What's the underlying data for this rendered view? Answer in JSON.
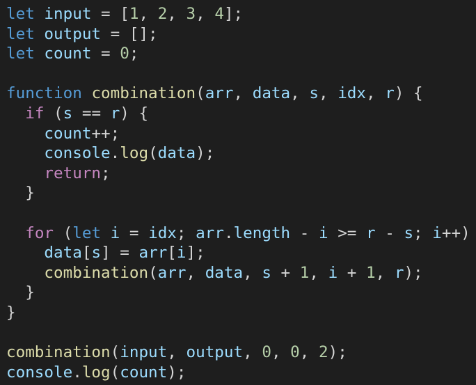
{
  "colors": {
    "background": "#1e1e1e",
    "keyword": "#569cd6",
    "control": "#c586c0",
    "variable": "#9cdcfe",
    "function": "#dcdcaa",
    "number": "#b5cea8",
    "punctuation": "#d4d4d4"
  },
  "lines": [
    [
      [
        "kw",
        "let"
      ],
      [
        "pun",
        " "
      ],
      [
        "var",
        "input"
      ],
      [
        "pun",
        " = ["
      ],
      [
        "num",
        "1"
      ],
      [
        "pun",
        ", "
      ],
      [
        "num",
        "2"
      ],
      [
        "pun",
        ", "
      ],
      [
        "num",
        "3"
      ],
      [
        "pun",
        ", "
      ],
      [
        "num",
        "4"
      ],
      [
        "pun",
        "];"
      ]
    ],
    [
      [
        "kw",
        "let"
      ],
      [
        "pun",
        " "
      ],
      [
        "var",
        "output"
      ],
      [
        "pun",
        " = [];"
      ]
    ],
    [
      [
        "kw",
        "let"
      ],
      [
        "pun",
        " "
      ],
      [
        "var",
        "count"
      ],
      [
        "pun",
        " = "
      ],
      [
        "num",
        "0"
      ],
      [
        "pun",
        ";"
      ]
    ],
    [],
    [
      [
        "kw",
        "function"
      ],
      [
        "pun",
        " "
      ],
      [
        "fn",
        "combination"
      ],
      [
        "pun",
        "("
      ],
      [
        "var",
        "arr"
      ],
      [
        "pun",
        ", "
      ],
      [
        "var",
        "data"
      ],
      [
        "pun",
        ", "
      ],
      [
        "var",
        "s"
      ],
      [
        "pun",
        ", "
      ],
      [
        "var",
        "idx"
      ],
      [
        "pun",
        ", "
      ],
      [
        "var",
        "r"
      ],
      [
        "pun",
        ") {"
      ]
    ],
    [
      [
        "pun",
        "  "
      ],
      [
        "ctl",
        "if"
      ],
      [
        "pun",
        " ("
      ],
      [
        "var",
        "s"
      ],
      [
        "pun",
        " == "
      ],
      [
        "var",
        "r"
      ],
      [
        "pun",
        ") {"
      ]
    ],
    [
      [
        "pun",
        "    "
      ],
      [
        "var",
        "count"
      ],
      [
        "pun",
        "++;"
      ]
    ],
    [
      [
        "pun",
        "    "
      ],
      [
        "var",
        "console"
      ],
      [
        "pun",
        "."
      ],
      [
        "fn",
        "log"
      ],
      [
        "pun",
        "("
      ],
      [
        "var",
        "data"
      ],
      [
        "pun",
        ");"
      ]
    ],
    [
      [
        "pun",
        "    "
      ],
      [
        "ctl",
        "return"
      ],
      [
        "pun",
        ";"
      ]
    ],
    [
      [
        "pun",
        "  }"
      ]
    ],
    [],
    [
      [
        "pun",
        "  "
      ],
      [
        "ctl",
        "for"
      ],
      [
        "pun",
        " ("
      ],
      [
        "kw",
        "let"
      ],
      [
        "pun",
        " "
      ],
      [
        "var",
        "i"
      ],
      [
        "pun",
        " = "
      ],
      [
        "var",
        "idx"
      ],
      [
        "pun",
        "; "
      ],
      [
        "var",
        "arr"
      ],
      [
        "pun",
        "."
      ],
      [
        "var",
        "length"
      ],
      [
        "pun",
        " - "
      ],
      [
        "var",
        "i"
      ],
      [
        "pun",
        " >= "
      ],
      [
        "var",
        "r"
      ],
      [
        "pun",
        " - "
      ],
      [
        "var",
        "s"
      ],
      [
        "pun",
        "; "
      ],
      [
        "var",
        "i"
      ],
      [
        "pun",
        "++) {"
      ]
    ],
    [
      [
        "pun",
        "    "
      ],
      [
        "var",
        "data"
      ],
      [
        "pun",
        "["
      ],
      [
        "var",
        "s"
      ],
      [
        "pun",
        "] = "
      ],
      [
        "var",
        "arr"
      ],
      [
        "pun",
        "["
      ],
      [
        "var",
        "i"
      ],
      [
        "pun",
        "];"
      ]
    ],
    [
      [
        "pun",
        "    "
      ],
      [
        "fn",
        "combination"
      ],
      [
        "pun",
        "("
      ],
      [
        "var",
        "arr"
      ],
      [
        "pun",
        ", "
      ],
      [
        "var",
        "data"
      ],
      [
        "pun",
        ", "
      ],
      [
        "var",
        "s"
      ],
      [
        "pun",
        " + "
      ],
      [
        "num",
        "1"
      ],
      [
        "pun",
        ", "
      ],
      [
        "var",
        "i"
      ],
      [
        "pun",
        " + "
      ],
      [
        "num",
        "1"
      ],
      [
        "pun",
        ", "
      ],
      [
        "var",
        "r"
      ],
      [
        "pun",
        ");"
      ]
    ],
    [
      [
        "pun",
        "  }"
      ]
    ],
    [
      [
        "pun",
        "}"
      ]
    ],
    [],
    [
      [
        "fn",
        "combination"
      ],
      [
        "pun",
        "("
      ],
      [
        "var",
        "input"
      ],
      [
        "pun",
        ", "
      ],
      [
        "var",
        "output"
      ],
      [
        "pun",
        ", "
      ],
      [
        "num",
        "0"
      ],
      [
        "pun",
        ", "
      ],
      [
        "num",
        "0"
      ],
      [
        "pun",
        ", "
      ],
      [
        "num",
        "2"
      ],
      [
        "pun",
        ");"
      ]
    ],
    [
      [
        "var",
        "console"
      ],
      [
        "pun",
        "."
      ],
      [
        "fn",
        "log"
      ],
      [
        "pun",
        "("
      ],
      [
        "var",
        "count"
      ],
      [
        "pun",
        ");"
      ]
    ]
  ]
}
